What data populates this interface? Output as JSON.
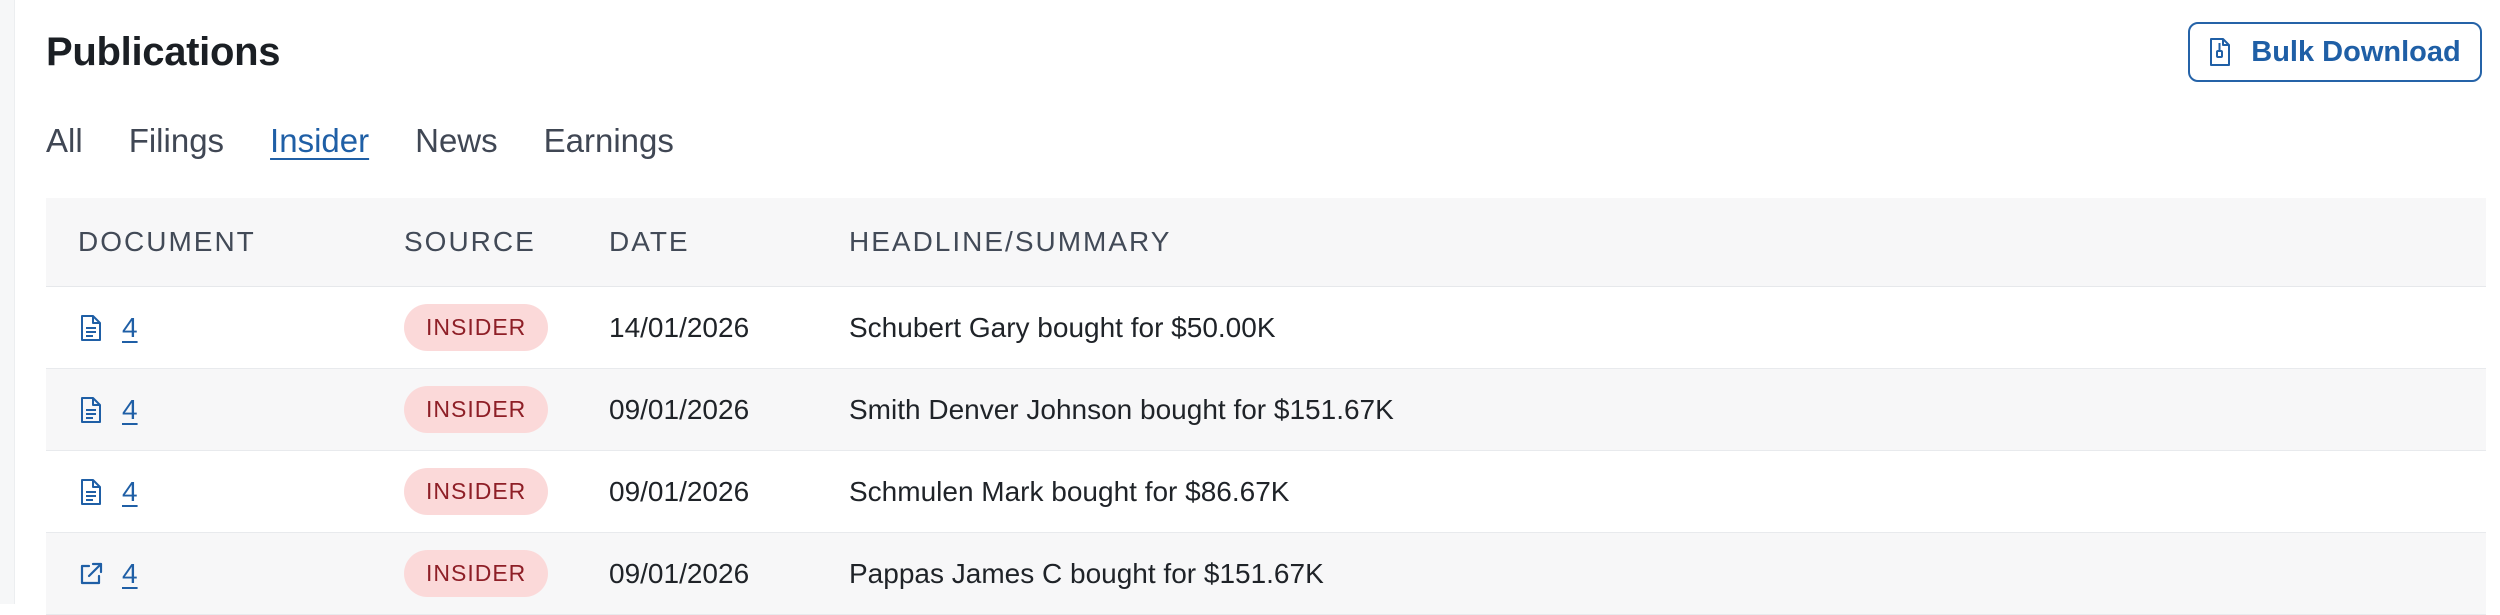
{
  "page": {
    "title": "Publications",
    "bulk_download_label": "Bulk Download"
  },
  "tabs": [
    {
      "label": "All",
      "active": false
    },
    {
      "label": "Filings",
      "active": false
    },
    {
      "label": "Insider",
      "active": true
    },
    {
      "label": "News",
      "active": false
    },
    {
      "label": "Earnings",
      "active": false
    }
  ],
  "table": {
    "columns": [
      "DOCUMENT",
      "SOURCE",
      "DATE",
      "HEADLINE/SUMMARY"
    ],
    "rows": [
      {
        "doc_icon": "document-icon",
        "doc": "4",
        "source": "INSIDER",
        "date": "14/01/2026",
        "headline": "Schubert Gary bought for $50.00K"
      },
      {
        "doc_icon": "document-icon",
        "doc": "4",
        "source": "INSIDER",
        "date": "09/01/2026",
        "headline": "Smith Denver Johnson bought for $151.67K"
      },
      {
        "doc_icon": "document-icon",
        "doc": "4",
        "source": "INSIDER",
        "date": "09/01/2026",
        "headline": "Schmulen Mark bought for $86.67K"
      },
      {
        "doc_icon": "external-link-icon",
        "doc": "4",
        "source": "INSIDER",
        "date": "09/01/2026",
        "headline": "Pappas James C bought for $151.67K"
      }
    ]
  },
  "colors": {
    "accent": "#1f5fa6",
    "badge_bg": "#fbd9d9",
    "badge_text": "#8e1f27",
    "header_bg": "#f7f7f8"
  }
}
